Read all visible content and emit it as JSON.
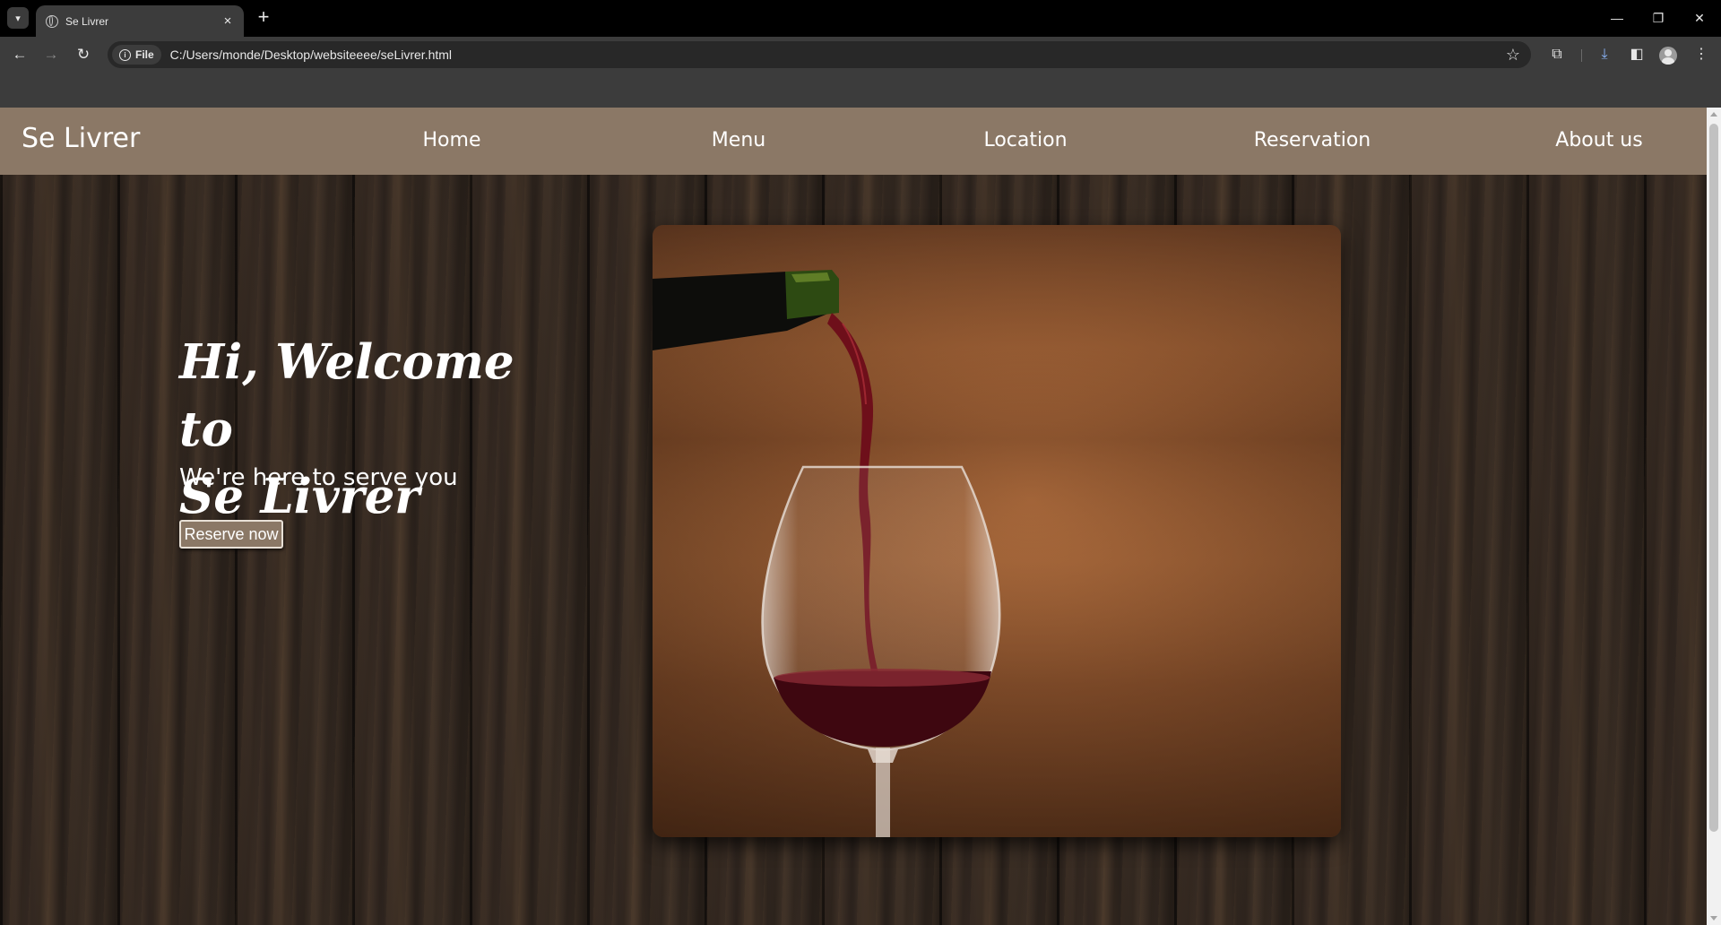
{
  "browser": {
    "tab_title": "Se Livrer",
    "tab_close": "×",
    "new_tab": "+",
    "site_chip_label": "File",
    "url": "C:/Users/monde/Desktop/websiteeee/seLivrer.html",
    "icons": {
      "tab_dropdown": "chevron-down-icon",
      "back": "back-arrow-icon",
      "forward": "forward-arrow-icon",
      "reload": "reload-icon",
      "bookmark": "star-icon",
      "extensions": "puzzle-icon",
      "downloads": "download-icon",
      "side_panel": "side-panel-icon",
      "profile": "avatar",
      "menu": "kebab-menu-icon"
    }
  },
  "site": {
    "brand": "Se Livrer",
    "nav": [
      {
        "label": "Home"
      },
      {
        "label": "Menu"
      },
      {
        "label": "Location"
      },
      {
        "label": "Reservation"
      },
      {
        "label": "About us"
      }
    ],
    "hero": {
      "title_line1": "Hi, Welcome to",
      "title_line2": "Se Livrer",
      "subtitle": "We're here to serve you",
      "cta_label": "Reserve now"
    },
    "colors": {
      "navbar": "#8b7866",
      "button": "#8b7866",
      "text": "#ffffff",
      "wood_background": "#2d241e"
    }
  }
}
